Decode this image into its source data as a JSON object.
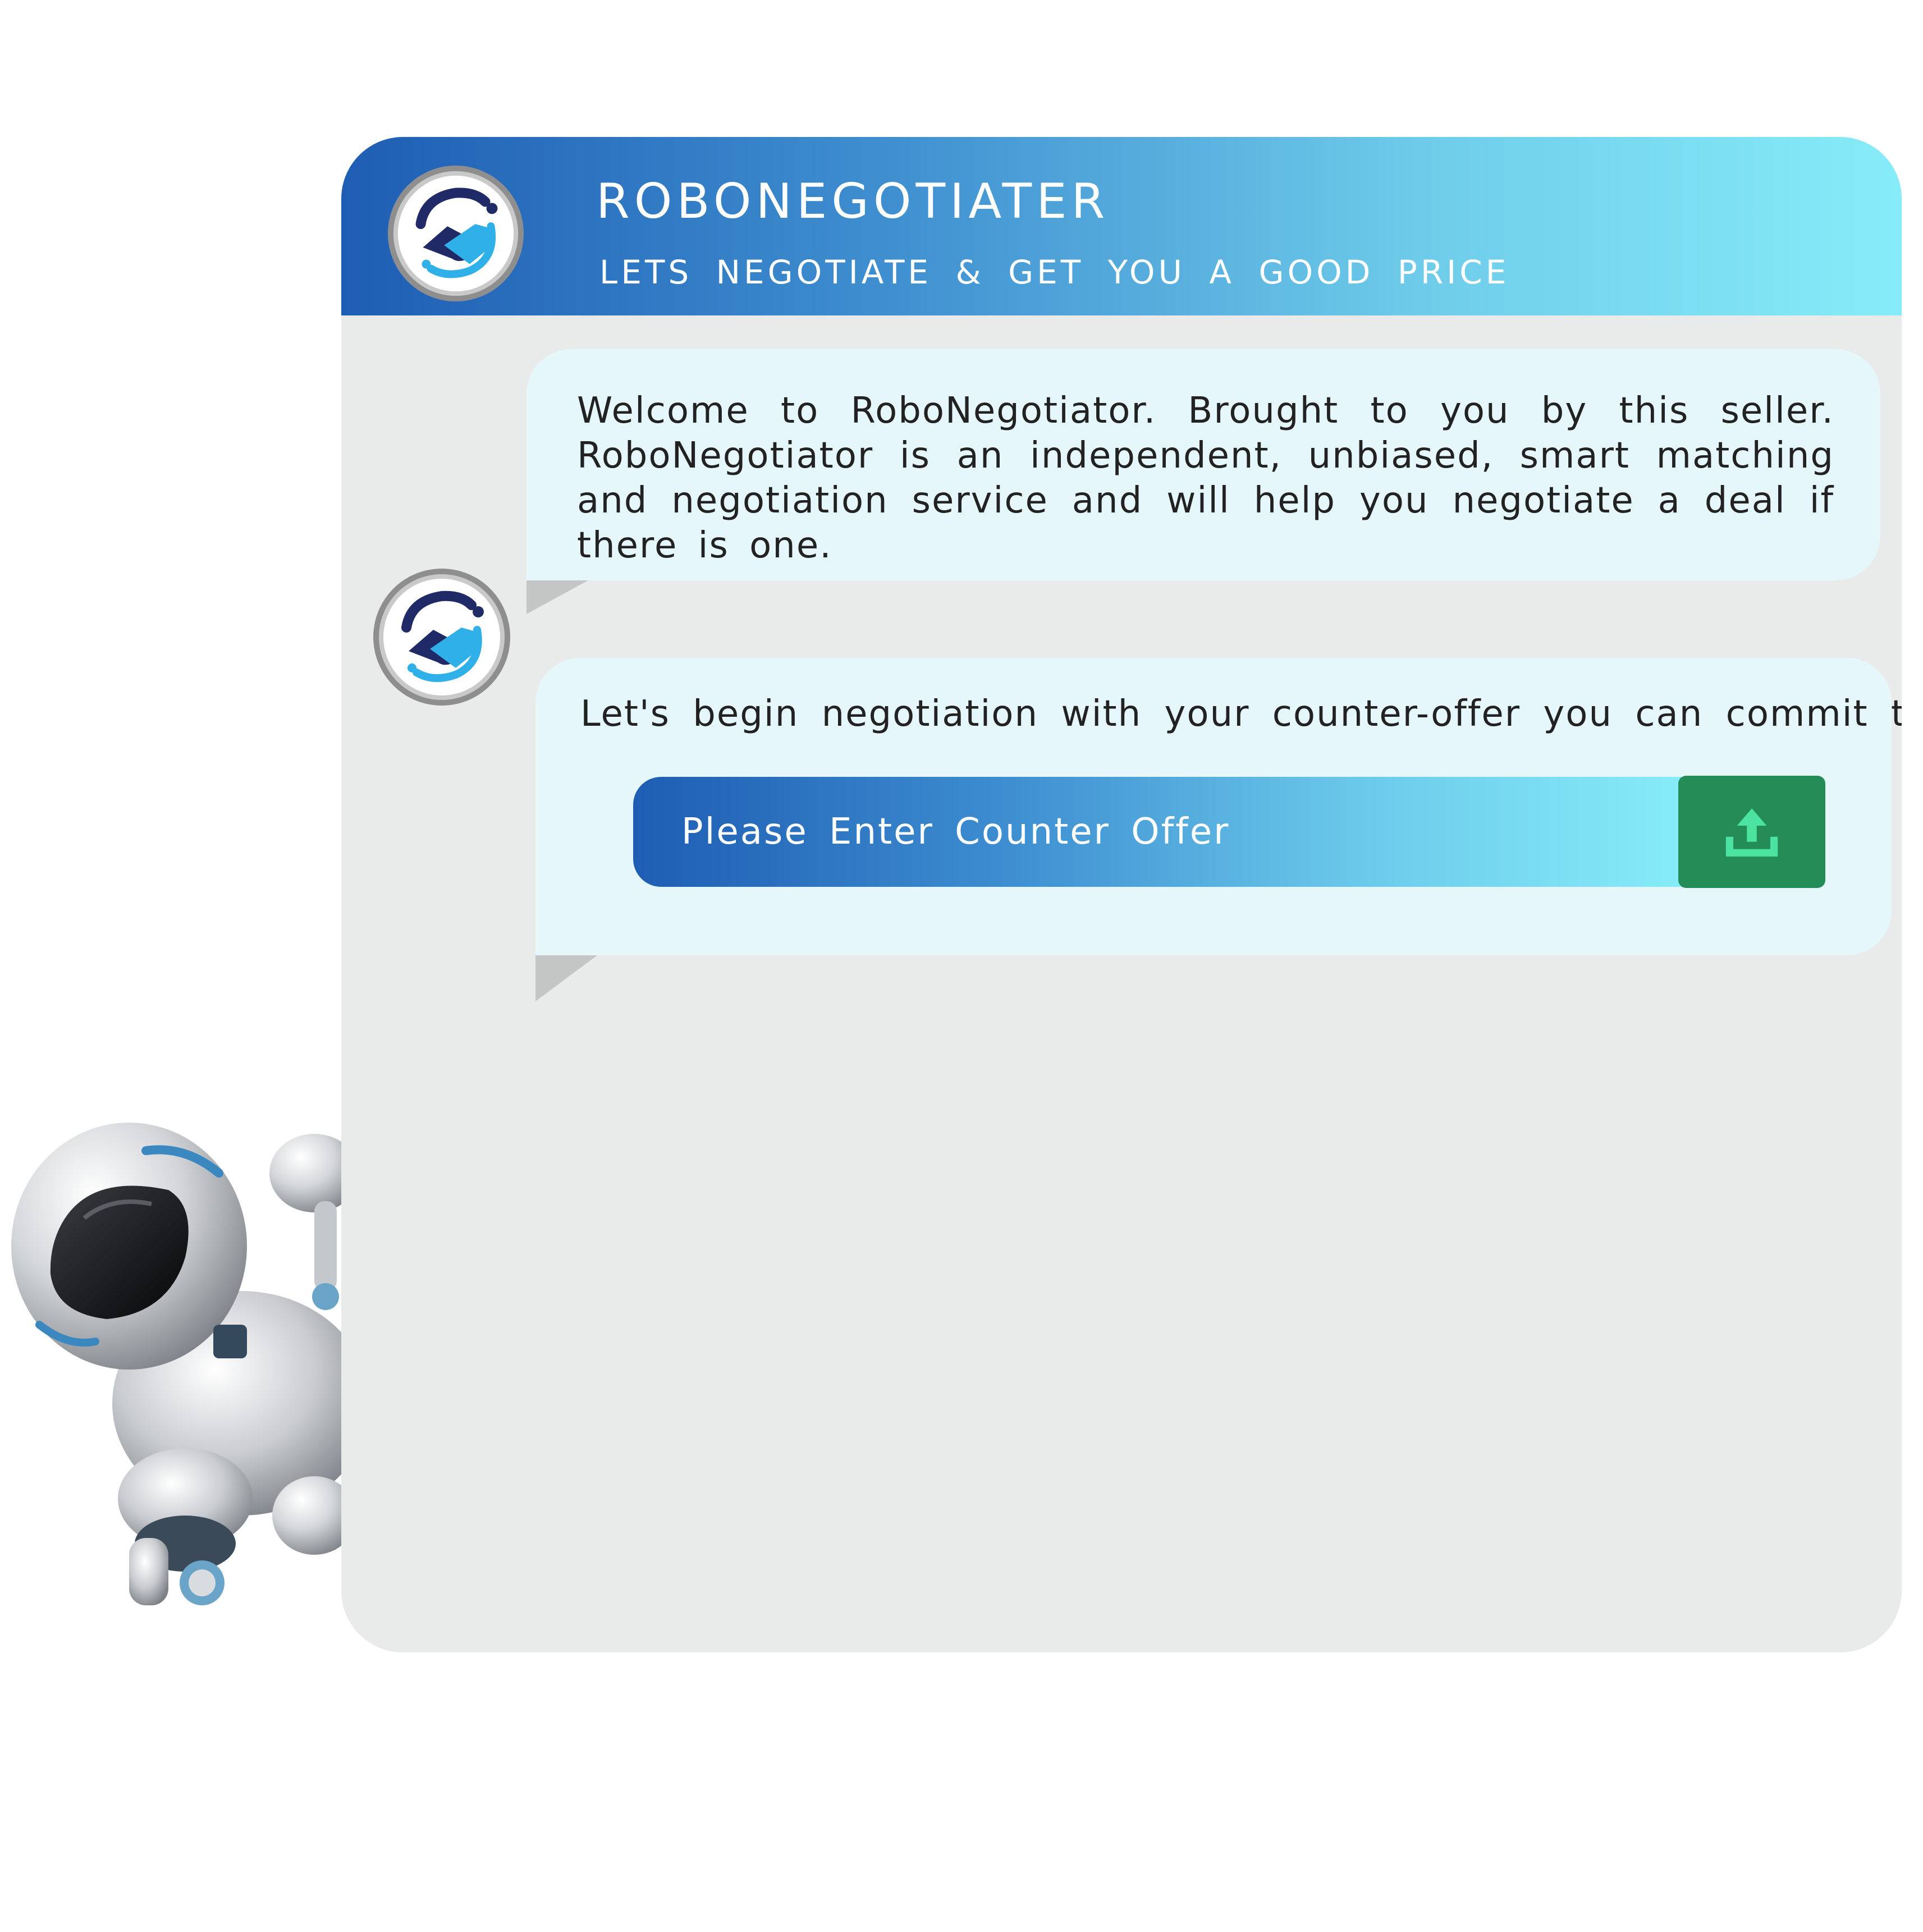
{
  "header": {
    "title": "ROBONEGOTIATER",
    "subtitle": "LETS NEGOTIATE & GET YOU A GOOD PRICE",
    "logo_icon": "handshake-logo-icon"
  },
  "messages": [
    {
      "sender": "bot",
      "text": "Welcome to RoboNegotiator. Brought to you by this seller. RoboNegotiator is an independent, unbiased, smart matching and negotiation service and will help you negotiate a deal if there is one."
    },
    {
      "sender": "bot",
      "text": "Let's begin negotiation with your counter-offer you can commit to"
    }
  ],
  "counter_offer": {
    "placeholder": "Please Enter Counter Offer",
    "value": "",
    "submit_icon": "upload-icon"
  },
  "mascot_icon": "robot-mascot-icon",
  "colors": {
    "header_start": "#1e5db3",
    "header_end": "#87ecf8",
    "chat_background": "#e9ebea",
    "bubble_background": "#e6f7fb",
    "submit_button": "#238c57",
    "upload_arrow": "#4ce3a0",
    "logo_dark": "#1f2a66",
    "logo_accent": "#2fb0e8"
  }
}
